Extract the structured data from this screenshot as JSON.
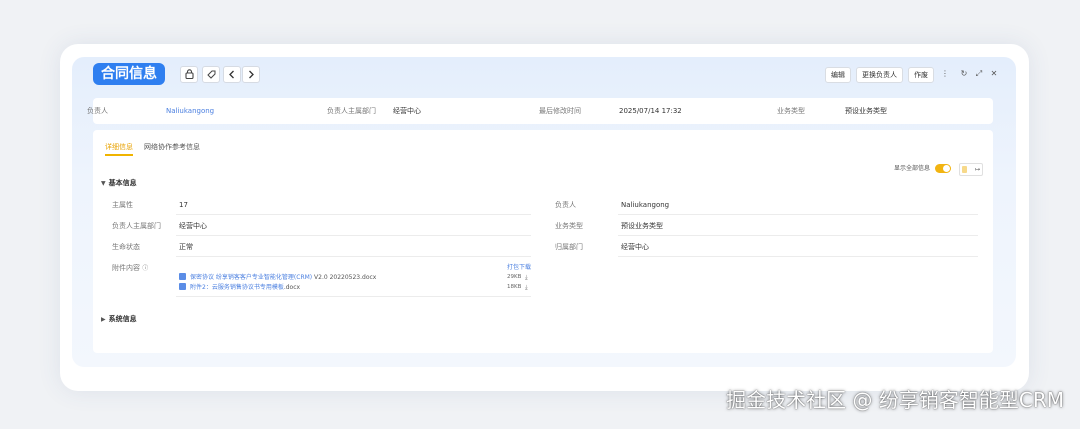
{
  "header": {
    "title": "合同信息",
    "icons": {
      "lock": "lock-icon",
      "tag": "tag-icon",
      "prev": "chevron-left-icon",
      "next": "chevron-right-icon"
    },
    "actions": {
      "edit": "编辑",
      "change_owner": "更换负责人",
      "void": "作废"
    },
    "window_icons": {
      "more": "⋮",
      "refresh": "↻",
      "expand": "⤢",
      "close": "✕"
    }
  },
  "summary": {
    "owner_label": "负责人",
    "owner_value": "Naliukangong",
    "owner_dept_label": "负责人主属部门",
    "owner_dept_value": "经营中心",
    "last_modified_label": "最后修改时间",
    "last_modified_value": "2025/07/14 17:32",
    "biz_type_label": "业务类型",
    "biz_type_value": "预设业务类型"
  },
  "tabs": [
    {
      "label": "详细信息",
      "active": true
    },
    {
      "label": "网络协作参考信息",
      "active": false
    }
  ],
  "toggle": {
    "label": "显示全部信息",
    "on": true
  },
  "basic_section": {
    "title": "基本信息",
    "fields": {
      "main_no_label": "主属性",
      "main_no_value": "17",
      "owner_label": "负责人",
      "owner_value": "Naliukangong",
      "owner_dept_label": "负责人主属部门",
      "owner_dept_value": "经营中心",
      "biz_type_label": "业务类型",
      "biz_type_value": "预设业务类型",
      "life_status_label": "生命状态",
      "life_status_value": "正常",
      "belong_dept_label": "归属部门",
      "belong_dept_value": "经营中心",
      "attachment_label": "附件内容",
      "pack_download": "打包下载"
    },
    "files": [
      {
        "name_link": "保密协议 纷享销客客户专业智能化管理(CRM)",
        "name_rest": " V2.0 20220523.docx",
        "size": "29KB"
      },
      {
        "name_link": "附件2：云服务销售协议书专用模板",
        "name_rest": ".docx",
        "size": "18KB"
      }
    ]
  },
  "system_section": {
    "title": "系统信息"
  },
  "watermark": "掘金技术社区 @ 纷享销客智能型CRM",
  "colors": {
    "accent": "#2f7ff0",
    "tab_active": "#e8a200",
    "toggle": "#f2b411",
    "link": "#4a7fe0"
  }
}
